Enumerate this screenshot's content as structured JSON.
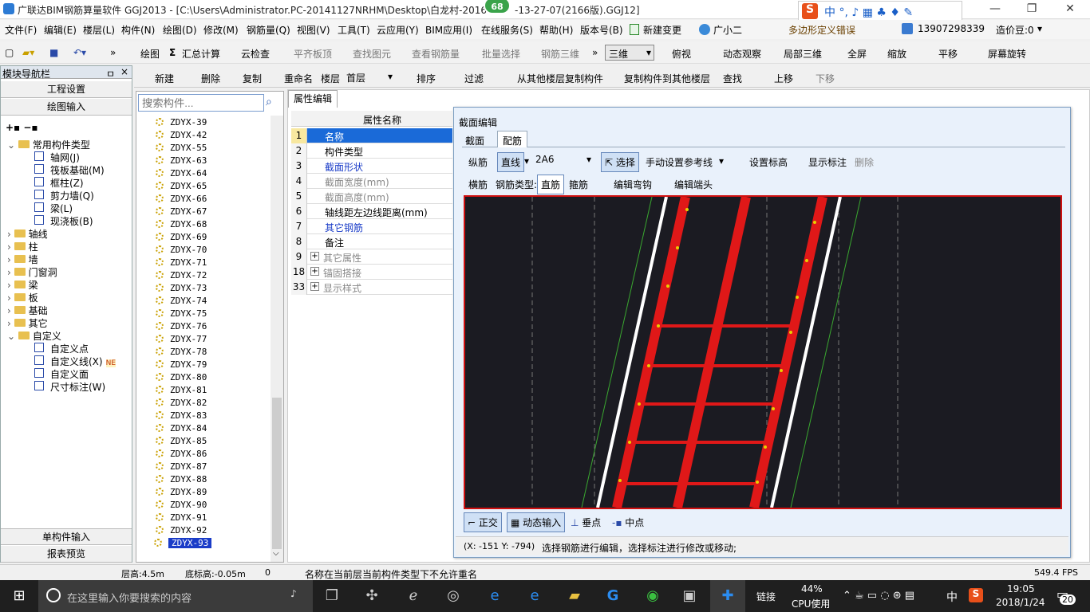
{
  "title": {
    "text": "广联达BIM钢筋算量软件 GGJ2013 - [C:\\Users\\Administrator.PC-20141127NRHM\\Desktop\\白龙村-2016",
    "suffix": "-13-27-07(2166版).GGJ12]",
    "badge": "68"
  },
  "menu": [
    "文件(F)",
    "编辑(E)",
    "楼层(L)",
    "构件(N)",
    "绘图(D)",
    "修改(M)",
    "钢筋量(Q)",
    "视图(V)",
    "工具(T)",
    "云应用(Y)",
    "BIM应用(I)",
    "在线服务(S)",
    "帮助(H)",
    "版本号(B)",
    "新建变更",
    "广小二"
  ],
  "menu_right": {
    "warning": "多边形定义错误",
    "phone": "13907298339",
    "coins": "造价豆:0"
  },
  "toolbar1": [
    "绘图",
    "汇总计算",
    "云检查",
    "平齐板顶",
    "查找图元",
    "查看钢筋量",
    "批量选择",
    "钢筋三维",
    "三维",
    "俯视",
    "动态观察",
    "局部三维",
    "全屏",
    "缩放",
    "平移",
    "屏幕旋转"
  ],
  "sidebar": {
    "header": "模块导航栏",
    "pin": "ㅁ",
    "close": "×",
    "btn_top": [
      "工程设置",
      "绘图输入"
    ],
    "btn_bottom": [
      "单构件输入",
      "报表预览"
    ],
    "tree": [
      {
        "label": "常用构件类型",
        "level": 0,
        "open": true
      },
      {
        "label": "轴网(J)",
        "level": 1
      },
      {
        "label": "筏板基础(M)",
        "level": 1
      },
      {
        "label": "框柱(Z)",
        "level": 1
      },
      {
        "label": "剪力墙(Q)",
        "level": 1
      },
      {
        "label": "梁(L)",
        "level": 1
      },
      {
        "label": "现浇板(B)",
        "level": 1
      },
      {
        "label": "轴线",
        "level": 0
      },
      {
        "label": "柱",
        "level": 0
      },
      {
        "label": "墙",
        "level": 0
      },
      {
        "label": "门窗洞",
        "level": 0
      },
      {
        "label": "梁",
        "level": 0
      },
      {
        "label": "板",
        "level": 0
      },
      {
        "label": "基础",
        "level": 0
      },
      {
        "label": "其它",
        "level": 0
      },
      {
        "label": "自定义",
        "level": 0,
        "open": true
      },
      {
        "label": "自定义点",
        "level": 1
      },
      {
        "label": "自定义线(X)",
        "level": 1,
        "badge": "NE"
      },
      {
        "label": "自定义面",
        "level": 1
      },
      {
        "label": "尺寸标注(W)",
        "level": 1
      }
    ]
  },
  "toolbar2": [
    "新建",
    "删除",
    "复制",
    "重命名",
    "楼层",
    "首层",
    "排序",
    "过滤",
    "从其他楼层复制构件",
    "复制构件到其他楼层",
    "查找",
    "上移",
    "下移"
  ],
  "complist": {
    "placeholder": "搜索构件...",
    "items": [
      "ZDYX-39",
      "ZDYX-42",
      "ZDYX-55",
      "ZDYX-63",
      "ZDYX-64",
      "ZDYX-65",
      "ZDYX-66",
      "ZDYX-67",
      "ZDYX-68",
      "ZDYX-69",
      "ZDYX-70",
      "ZDYX-71",
      "ZDYX-72",
      "ZDYX-73",
      "ZDYX-74",
      "ZDYX-75",
      "ZDYX-76",
      "ZDYX-77",
      "ZDYX-78",
      "ZDYX-79",
      "ZDYX-80",
      "ZDYX-81",
      "ZDYX-82",
      "ZDYX-83",
      "ZDYX-84",
      "ZDYX-85",
      "ZDYX-86",
      "ZDYX-87",
      "ZDYX-88",
      "ZDYX-89",
      "ZDYX-90",
      "ZDYX-91",
      "ZDYX-92",
      "ZDYX-93"
    ],
    "selected": "ZDYX-93"
  },
  "prop": {
    "tab": "属性编辑",
    "header": "属性名称",
    "rows": [
      {
        "num": "1",
        "name": "名称"
      },
      {
        "num": "2",
        "name": "构件类型"
      },
      {
        "num": "3",
        "name": "截面形状"
      },
      {
        "num": "4",
        "name": "截面宽度(mm)"
      },
      {
        "num": "5",
        "name": "截面高度(mm)"
      },
      {
        "num": "6",
        "name": "轴线距左边线距离(mm)"
      },
      {
        "num": "7",
        "name": "其它钢筋"
      },
      {
        "num": "8",
        "name": "备注"
      },
      {
        "num": "9",
        "name": "其它属性"
      },
      {
        "num": "18",
        "name": "锚固搭接"
      },
      {
        "num": "33",
        "name": "显示样式"
      }
    ]
  },
  "dialog": {
    "title": "截面编辑",
    "tabs": [
      "截面",
      "配筋"
    ],
    "row1": {
      "label": "纵筋",
      "mode": "直线",
      "value": "2A6",
      "select": "选择",
      "refline": "手动设置参考线",
      "setheight": "设置标高",
      "showmark": "显示标注",
      "delete": "删除"
    },
    "row2": {
      "label": "横筋",
      "type_label": "钢筋类型:",
      "type": "直筋",
      "stirrup": "箍筋",
      "editbend": "编辑弯钩",
      "edithead": "编辑端头"
    },
    "snap": [
      "正交",
      "动态输入",
      "垂点",
      "中点"
    ],
    "coords": "(X: -151 Y: -794)",
    "hint": "选择钢筋进行编辑，选择标注进行修改或移动;"
  },
  "status": {
    "floor_height": "层高:4.5m",
    "base_height": "底标高:-0.05m",
    "zero": "0",
    "message": "名称在当前层当前构件类型下不允许重名",
    "fps": "549.4 FPS"
  },
  "taskbar": {
    "search": "在这里输入你要搜索的内容",
    "link": "链接",
    "cpu_pct": "44%",
    "cpu_label": "CPU使用",
    "ime": "中",
    "time": "19:05",
    "date": "2018/1/24",
    "notif": "20"
  },
  "colors": {
    "rebar": "#e01818",
    "canvas": "#1b1b22",
    "accent": "#0078d7"
  }
}
